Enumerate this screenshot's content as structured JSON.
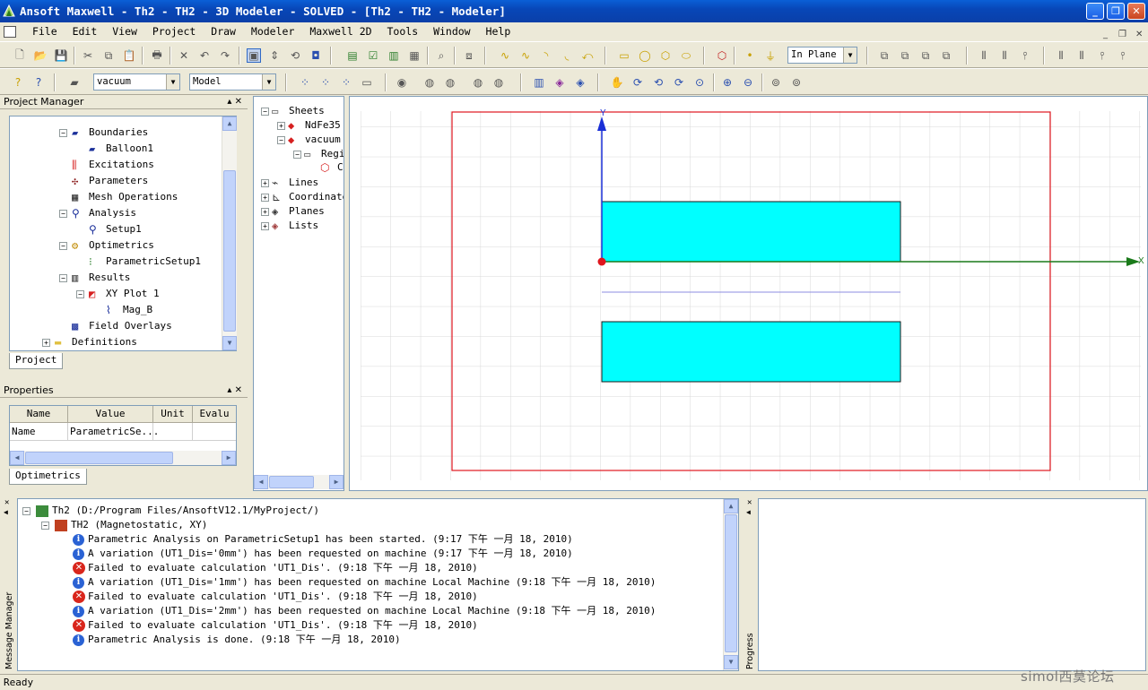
{
  "window": {
    "title": "Ansoft Maxwell - Th2 - TH2 - 3D Modeler - SOLVED - [Th2 - TH2 - Modeler]",
    "minimize": "_",
    "restore": "❐",
    "close": "✕"
  },
  "menu": [
    "File",
    "Edit",
    "View",
    "Project",
    "Draw",
    "Modeler",
    "Maxwell 2D",
    "Tools",
    "Window",
    "Help"
  ],
  "toolbar": {
    "plane_select": "In Plane",
    "material_select": "vacuum",
    "model_select": "Model"
  },
  "project_manager": {
    "title": "Project Manager",
    "tree": [
      {
        "label": "Boundaries",
        "icon": "boundary-icon",
        "level": 0,
        "exp": "−"
      },
      {
        "label": "Balloon1",
        "icon": "balloon-icon",
        "level": 1,
        "exp": ""
      },
      {
        "label": "Excitations",
        "icon": "excitation-icon",
        "level": 0,
        "exp": ""
      },
      {
        "label": "Parameters",
        "icon": "parameters-icon",
        "level": 0,
        "exp": ""
      },
      {
        "label": "Mesh Operations",
        "icon": "mesh-icon",
        "level": 0,
        "exp": ""
      },
      {
        "label": "Analysis",
        "icon": "analysis-icon",
        "level": 0,
        "exp": "−"
      },
      {
        "label": "Setup1",
        "icon": "setup-icon",
        "level": 1,
        "exp": ""
      },
      {
        "label": "Optimetrics",
        "icon": "optimetrics-icon",
        "level": 0,
        "exp": "−"
      },
      {
        "label": "ParametricSetup1",
        "icon": "parametric-icon",
        "level": 1,
        "exp": ""
      },
      {
        "label": "Results",
        "icon": "results-icon",
        "level": 0,
        "exp": "−"
      },
      {
        "label": "XY Plot 1",
        "icon": "xyplot-icon",
        "level": 1,
        "exp": "−"
      },
      {
        "label": "Mag_B",
        "icon": "trace-icon",
        "level": 2,
        "exp": ""
      },
      {
        "label": "Field Overlays",
        "icon": "field-icon",
        "level": 0,
        "exp": ""
      },
      {
        "label": "Definitions",
        "icon": "folder-icon",
        "level": -1,
        "exp": "+"
      }
    ],
    "tab": "Project"
  },
  "properties": {
    "title": "Properties",
    "columns": [
      "Name",
      "Value",
      "Unit",
      "Evalu"
    ],
    "rows": [
      [
        "Name",
        "ParametricSe...",
        "",
        ""
      ]
    ],
    "tab": "Optimetrics"
  },
  "model_tree": [
    {
      "label": "Sheets",
      "level": 0,
      "exp": "−"
    },
    {
      "label": "NdFe35",
      "level": 1,
      "exp": "+"
    },
    {
      "label": "vacuum",
      "level": 1,
      "exp": "−"
    },
    {
      "label": "Regi",
      "level": 2,
      "exp": "−"
    },
    {
      "label": "C",
      "level": 3,
      "exp": ""
    },
    {
      "label": "Lines",
      "level": 0,
      "exp": "+"
    },
    {
      "label": "Coordinate",
      "level": 0,
      "exp": "+"
    },
    {
      "label": "Planes",
      "level": 0,
      "exp": "+"
    },
    {
      "label": "Lists",
      "level": 0,
      "exp": "+"
    }
  ],
  "axes": {
    "x": "X",
    "y": "Y"
  },
  "messages": {
    "side_label": "Message Manager",
    "project": "Th2  (D:/Program Files/AnsoftV12.1/MyProject/)",
    "design": "TH2  (Magnetostatic, XY)",
    "items": [
      {
        "type": "info",
        "text": "Parametric Analysis on ParametricSetup1 has been started.  (9:17 下午  一月 18, 2010)"
      },
      {
        "type": "info",
        "text": "A variation (UT1_Dis='0mm') has been requested on machine  (9:17 下午  一月 18, 2010)"
      },
      {
        "type": "error",
        "text": "Failed to evaluate calculation 'UT1_Dis'.  (9:18 下午  一月 18, 2010)"
      },
      {
        "type": "info",
        "text": "A variation (UT1_Dis='1mm') has been requested on machine Local Machine (9:18 下午  一月 18, 2010)"
      },
      {
        "type": "error",
        "text": "Failed to evaluate calculation 'UT1_Dis'.  (9:18 下午  一月 18, 2010)"
      },
      {
        "type": "info",
        "text": "A variation (UT1_Dis='2mm') has been requested on machine Local Machine (9:18 下午  一月 18, 2010)"
      },
      {
        "type": "error",
        "text": "Failed to evaluate calculation 'UT1_Dis'.  (9:18 下午  一月 18, 2010)"
      },
      {
        "type": "info",
        "text": "Parametric Analysis is done.  (9:18 下午  一月 18, 2010)"
      }
    ]
  },
  "progress": {
    "side_label": "Progress"
  },
  "status": "Ready",
  "watermark": "simol西莫论坛",
  "colors": {
    "magnet": "#00ffff",
    "region": "#e0161e",
    "x_axis": "#1a7a1a",
    "y_axis": "#1a2fd6"
  }
}
